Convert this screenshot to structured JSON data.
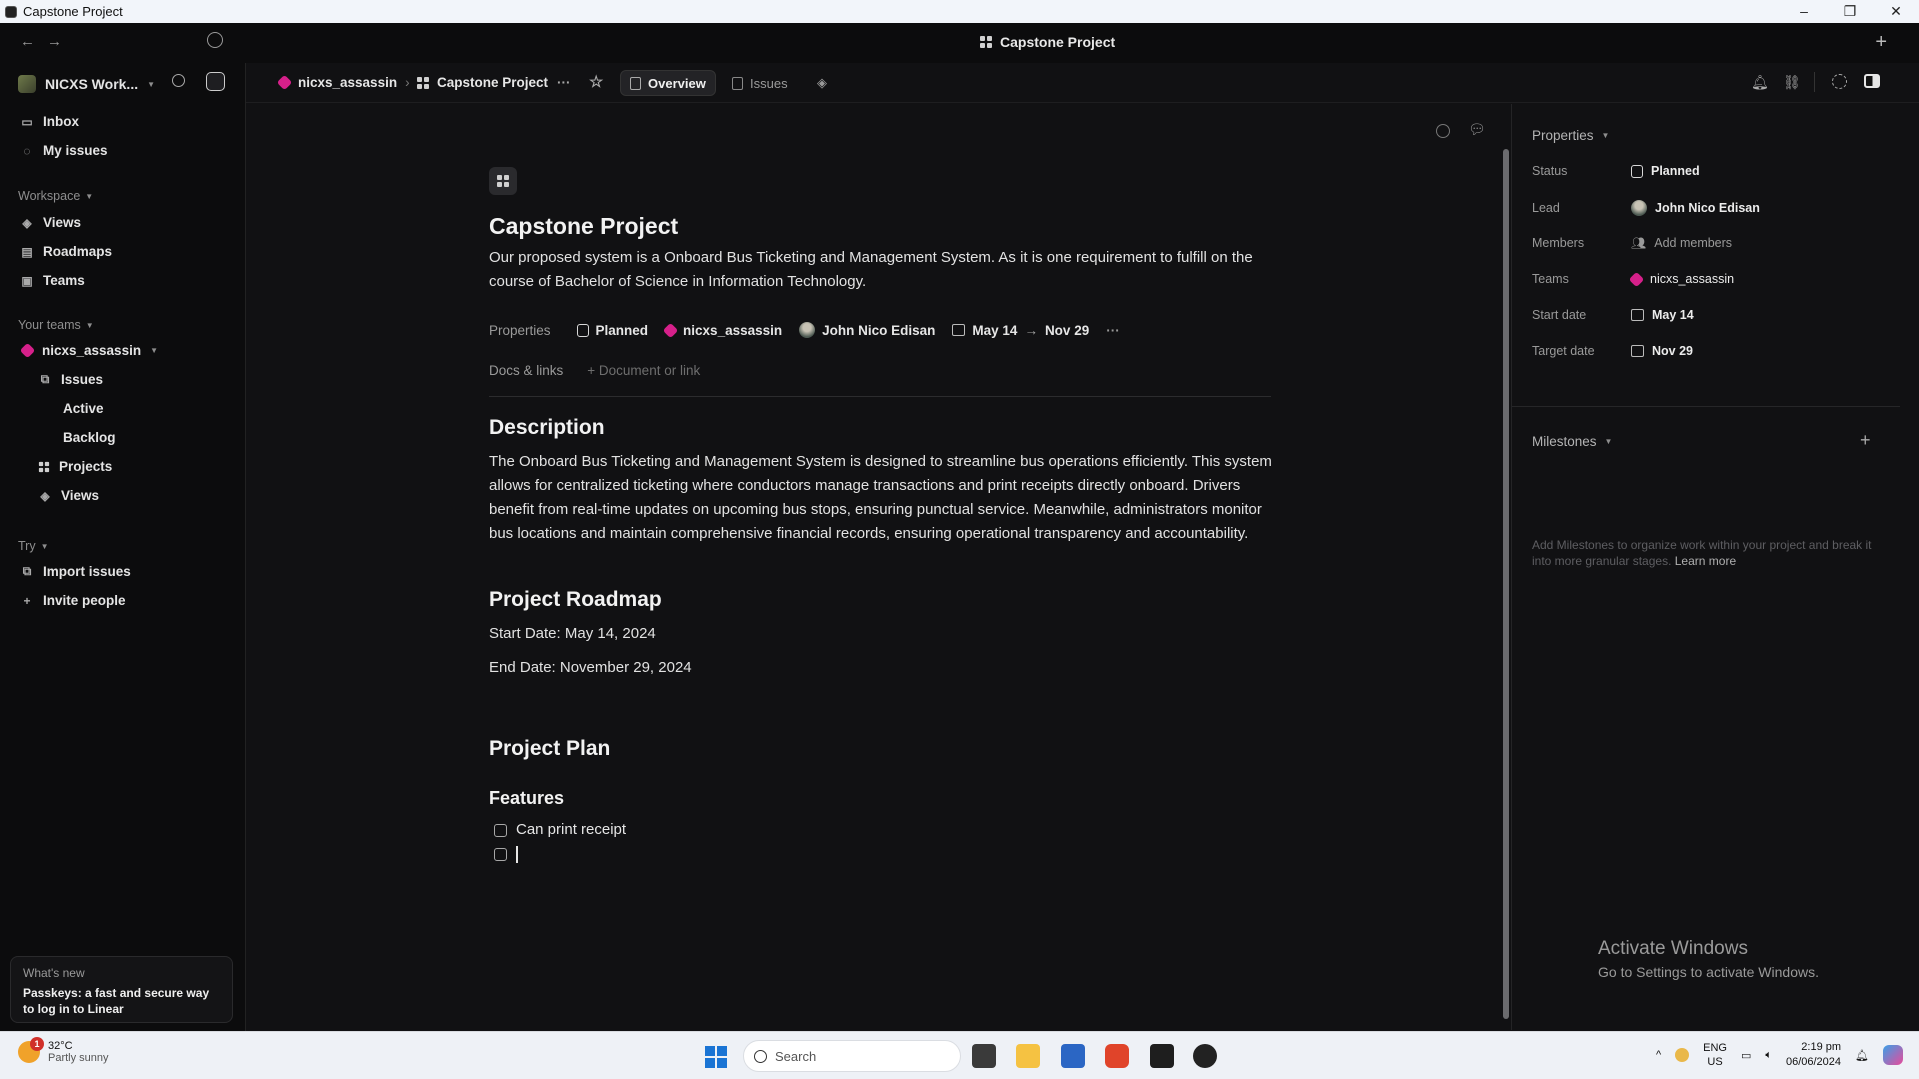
{
  "window": {
    "title": "Capstone Project",
    "controls": [
      "–",
      "❐",
      "✕"
    ]
  },
  "appbar": {
    "center_title": "Capstone Project"
  },
  "sidebar": {
    "workspace_name": "NICXS Work...",
    "inbox": "Inbox",
    "my_issues": "My issues",
    "workspace_header": "Workspace",
    "workspace_items": [
      "Views",
      "Roadmaps",
      "Teams"
    ],
    "your_teams_header": "Your teams",
    "team_name": "nicxs_assassin",
    "team_items": [
      "Issues",
      "Active",
      "Backlog",
      "Projects",
      "Views"
    ],
    "try_header": "Try",
    "try_items": [
      "Import issues",
      "Invite people"
    ],
    "whats_new_label": "What's new",
    "whats_new_text": "Passkeys: a fast and secure way to log in to Linear"
  },
  "breadcrumb": {
    "team": "nicxs_assassin",
    "project": "Capstone Project",
    "more": "···",
    "tabs": [
      "Overview",
      "Issues"
    ]
  },
  "project": {
    "title": "Capstone Project",
    "summary": "Our proposed system is a Onboard Bus Ticketing and Management System. As it is one requirement to fulfill on the course of Bachelor of Science in Information Technology.",
    "properties_label": "Properties",
    "status": "Planned",
    "team": "nicxs_assassin",
    "lead": "John Nico Edisan",
    "start": "May 14",
    "arrow": "→",
    "end": "Nov 29",
    "docs_label": "Docs & links",
    "docs_add": "Document or link",
    "description_heading": "Description",
    "description": "The Onboard Bus Ticketing and Management System is designed to streamline bus operations efficiently. This system allows for centralized ticketing where conductors manage transactions and print receipts directly onboard. Drivers benefit from real-time updates on upcoming bus stops, ensuring punctual service. Meanwhile, administrators monitor bus locations and maintain comprehensive financial records, ensuring operational transparency and accountability.",
    "roadmap_heading": "Project Roadmap",
    "roadmap_start": "Start Date: May 14, 2024",
    "roadmap_end": "End Date: November 29, 2024",
    "plan_heading": "Project Plan",
    "features_heading": "Features",
    "features": [
      "Can print receipt",
      ""
    ]
  },
  "right_panel": {
    "properties_header": "Properties",
    "rows": [
      {
        "key": "Status",
        "value": "Planned"
      },
      {
        "key": "Lead",
        "value": "John Nico Edisan"
      },
      {
        "key": "Members",
        "value": "Add members"
      },
      {
        "key": "Teams",
        "value": "nicxs_assassin"
      },
      {
        "key": "Start date",
        "value": "May 14"
      },
      {
        "key": "Target date",
        "value": "Nov 29"
      }
    ],
    "milestones_header": "Milestones",
    "milestones_note": "Add Milestones to organize work within your project and break it into more granular stages.",
    "learn_more": "Learn more"
  },
  "watermark": {
    "line1": "Activate Windows",
    "line2": "Go to Settings to activate Windows."
  },
  "taskbar": {
    "weather_temp": "32°C",
    "weather_desc": "Partly sunny",
    "weather_badge": "1",
    "search_placeholder": "Search",
    "lang1": "ENG",
    "lang2": "US",
    "time": "2:19 pm",
    "date": "06/06/2024"
  },
  "colors": {
    "accent_team": "#d6208a",
    "background": "#111113",
    "sidebar": "#0c0c0d"
  }
}
